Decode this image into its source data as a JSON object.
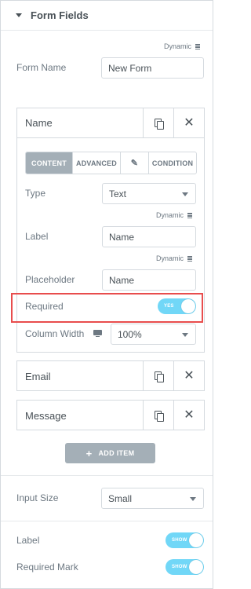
{
  "section": {
    "title": "Form Fields"
  },
  "dynamic_label": "Dynamic",
  "form_name": {
    "label": "Form Name",
    "value": "New Form"
  },
  "fields": [
    {
      "title": "Name",
      "tabs": [
        "CONTENT",
        "ADVANCED",
        "CONDITION"
      ],
      "active_tab": "CONTENT",
      "type": {
        "label": "Type",
        "value": "Text"
      },
      "label": {
        "label": "Label",
        "value": "Name"
      },
      "placeholder": {
        "label": "Placeholder",
        "value": "Name"
      },
      "required": {
        "label": "Required",
        "toggle": "YES"
      },
      "column_width": {
        "label": "Column Width",
        "value": "100%"
      }
    },
    {
      "title": "Email"
    },
    {
      "title": "Message"
    }
  ],
  "add_item_label": "ADD ITEM",
  "input_size": {
    "label": "Input Size",
    "value": "Small"
  },
  "label_toggle": {
    "label": "Label",
    "toggle": "SHOW"
  },
  "required_mark": {
    "label": "Required Mark",
    "toggle": "SHOW"
  },
  "colors": {
    "toggle_on": "#71d7f7",
    "highlight": "#e84d4d",
    "active_tab": "#a4afb7"
  },
  "icons": [
    "caret-down-icon",
    "database-icon",
    "copy-icon",
    "close-icon",
    "magic-wand-icon",
    "desktop-icon",
    "plus-icon",
    "chevron-down-icon"
  ]
}
